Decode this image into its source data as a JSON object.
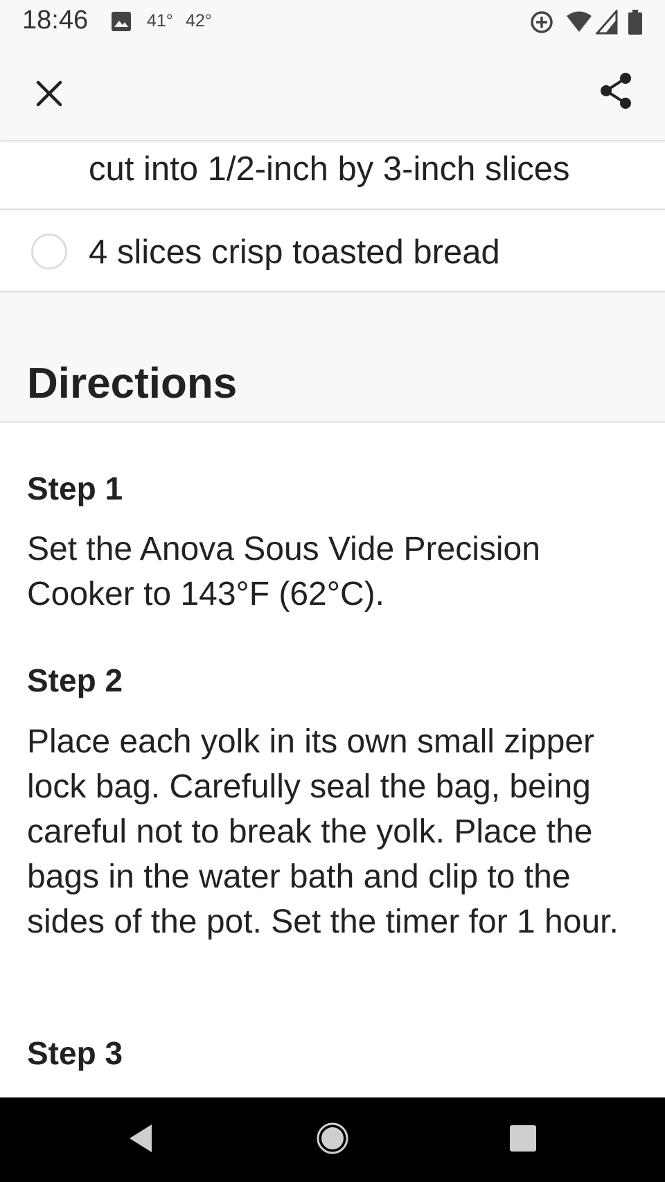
{
  "status_bar": {
    "time": "18:46",
    "temp_now": "41°",
    "temp_high": "42°",
    "icons": [
      "image-icon",
      "data-saver-icon",
      "wifi-icon",
      "signal-icon",
      "battery-icon"
    ]
  },
  "top_bar": {
    "close_icon": "close-icon",
    "share_icon": "share-icon"
  },
  "ingredients": {
    "partial_item": "cut into 1/2-inch by 3-inch slices",
    "items": [
      {
        "label": "4 slices crisp toasted bread",
        "checked": false
      }
    ]
  },
  "directions": {
    "title": "Directions",
    "steps": [
      {
        "title": "Step 1",
        "text": "Set the Anova Sous Vide Precision Cooker to 143°F (62°C)."
      },
      {
        "title": "Step 2",
        "text": "Place each yolk in its own small zipper lock bag. Carefully seal the bag, being careful not to break the yolk. Place the bags in the water bath and clip to the sides of the pot. Set the timer for 1 hour."
      },
      {
        "title": "Step 3",
        "text": ""
      }
    ]
  },
  "nav_bar": {
    "icons": [
      "back-icon",
      "home-icon",
      "recents-icon"
    ]
  },
  "colors": {
    "header_bg": "#faf8f6",
    "text": "#222222",
    "divider": "#dcdcdc",
    "nav_bg": "#000000"
  }
}
